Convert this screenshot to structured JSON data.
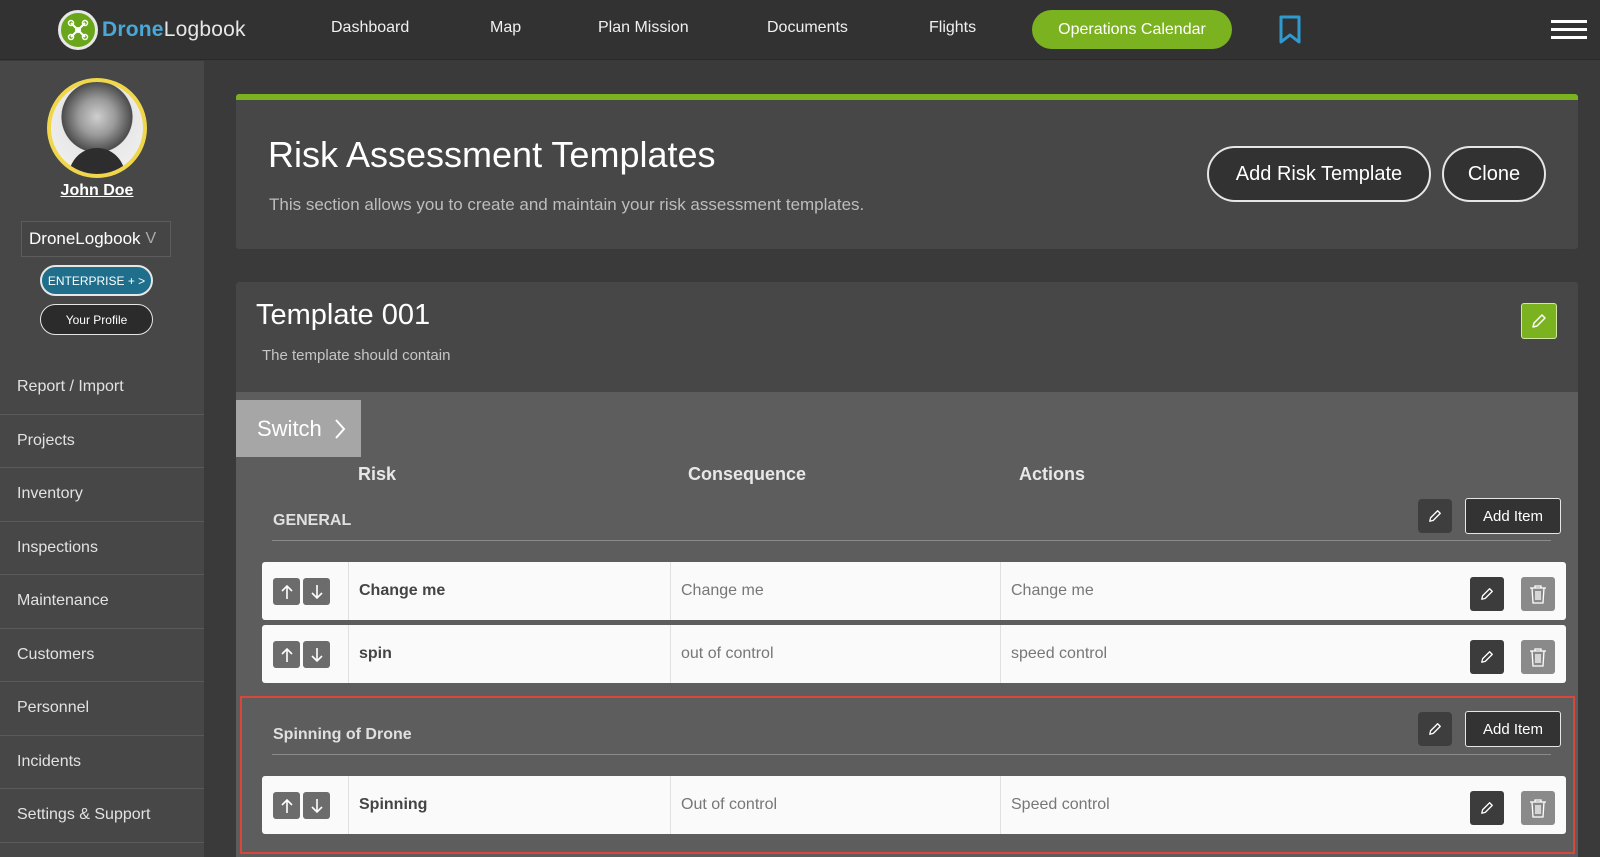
{
  "nav": {
    "brand": "Drone",
    "brand_rest": "Logbook",
    "links": [
      "Dashboard",
      "Map",
      "Plan Mission",
      "Documents",
      "Flights"
    ],
    "ops_button": "Operations Calendar",
    "icons": [
      "bookmark-icon",
      "hamburger-menu-icon"
    ]
  },
  "user": {
    "name": "John Doe",
    "org": "DroneLogbook",
    "org_chevron": "V",
    "plan": "ENTERPRISE + >",
    "profile": "Your Profile"
  },
  "sidebar": {
    "items": [
      "Report / Import",
      "Projects",
      "Inventory",
      "Inspections",
      "Maintenance",
      "Customers",
      "Personnel",
      "Incidents",
      "Settings & Support"
    ]
  },
  "header": {
    "title": "Risk Assessment Templates",
    "subtitle": "This section allows you to create and maintain your risk assessment templates.",
    "add_button": "Add Risk Template",
    "clone_button": "Clone"
  },
  "template": {
    "title": "Template 001",
    "subtitle": "The template should contain",
    "switch_label": "Switch",
    "columns": {
      "risk": "Risk",
      "consequence": "Consequence",
      "actions": "Actions"
    },
    "add_item_label": "Add Item",
    "sections": [
      {
        "name": "GENERAL",
        "rows": [
          {
            "risk": "Change me",
            "consequence": "Change me",
            "actions": "Change me"
          },
          {
            "risk": "spin",
            "consequence": "out of control",
            "actions": "speed control"
          }
        ]
      },
      {
        "name": "Spinning of Drone",
        "rows": [
          {
            "risk": "Spinning",
            "consequence": "Out of control",
            "actions": "Speed control"
          }
        ]
      }
    ]
  },
  "colors": {
    "accent": "#7bb21f",
    "brand_blue": "#4aa8d8",
    "highlight": "#d9473b",
    "enterprise": "#1e6e8c"
  }
}
